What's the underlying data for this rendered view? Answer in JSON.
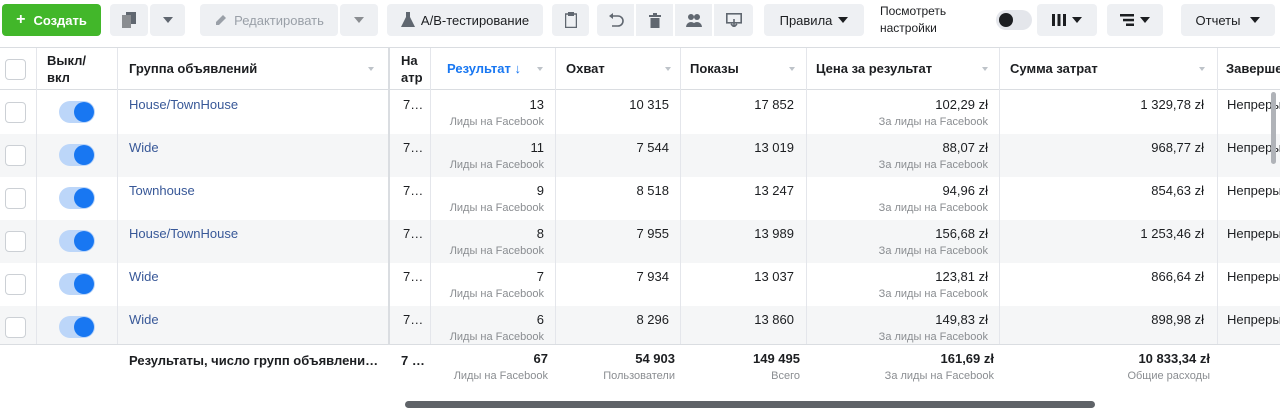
{
  "toolbar": {
    "create_label": "Создать",
    "edit_label": "Редактировать",
    "ab_label": "A/B-тестирование",
    "rules_label": "Правила",
    "settings_label": "Посмотреть настройки",
    "reports_label": "Отчеты",
    "view_settings_toggle": false,
    "accent_color": "#42b72a"
  },
  "table": {
    "headers": {
      "toggle": "Выкл/ вкл",
      "adset": "Группа объявлений",
      "attribution": "На атр",
      "results": "Результат ↓",
      "reach": "Охват",
      "impressions": "Показы",
      "cost_per_result": "Цена за результат",
      "spend": "Сумма затрат",
      "end": "Заверше"
    },
    "rows": [
      {
        "name": "House/TownHouse",
        "attr": "7…",
        "result": "13",
        "result_sub": "Лиды на Facebook",
        "reach": "10 315",
        "impressions": "17 852",
        "cpr": "102,29 zł",
        "cpr_sub": "За лиды на Facebook",
        "spend": "1 329,78 zł",
        "end": "Непреры",
        "on": true
      },
      {
        "name": "Wide",
        "attr": "7…",
        "result": "11",
        "result_sub": "Лиды на Facebook",
        "reach": "7 544",
        "impressions": "13 019",
        "cpr": "88,07 zł",
        "cpr_sub": "За лиды на Facebook",
        "spend": "968,77 zł",
        "end": "Непреры",
        "on": true
      },
      {
        "name": "Townhouse",
        "attr": "7…",
        "result": "9",
        "result_sub": "Лиды на Facebook",
        "reach": "8 518",
        "impressions": "13 247",
        "cpr": "94,96 zł",
        "cpr_sub": "За лиды на Facebook",
        "spend": "854,63 zł",
        "end": "Непреры",
        "on": true
      },
      {
        "name": "House/TownHouse",
        "attr": "7…",
        "result": "8",
        "result_sub": "Лиды на Facebook",
        "reach": "7 955",
        "impressions": "13 989",
        "cpr": "156,68 zł",
        "cpr_sub": "За лиды на Facebook",
        "spend": "1 253,46 zł",
        "end": "Непреры",
        "on": true
      },
      {
        "name": "Wide",
        "attr": "7…",
        "result": "7",
        "result_sub": "Лиды на Facebook",
        "reach": "7 934",
        "impressions": "13 037",
        "cpr": "123,81 zł",
        "cpr_sub": "За лиды на Facebook",
        "spend": "866,64 zł",
        "end": "Непреры",
        "on": true
      },
      {
        "name": "Wide",
        "attr": "7…",
        "result": "6",
        "result_sub": "Лиды на Facebook",
        "reach": "8 296",
        "impressions": "13 860",
        "cpr": "149,83 zł",
        "cpr_sub": "За лиды на Facebook",
        "spend": "898,98 zł",
        "end": "Непреры",
        "on": true
      }
    ],
    "totals": {
      "label": "Результаты, число групп объявлени…",
      "attr": "7 …",
      "result": "67",
      "result_sub": "Лиды на Facebook",
      "reach": "54 903",
      "reach_sub": "Пользователи",
      "impressions": "149 495",
      "impressions_sub": "Всего",
      "cpr": "161,69 zł",
      "cpr_sub": "За лиды на Facebook",
      "spend": "10 833,34 zł",
      "spend_sub": "Общие расходы"
    }
  }
}
